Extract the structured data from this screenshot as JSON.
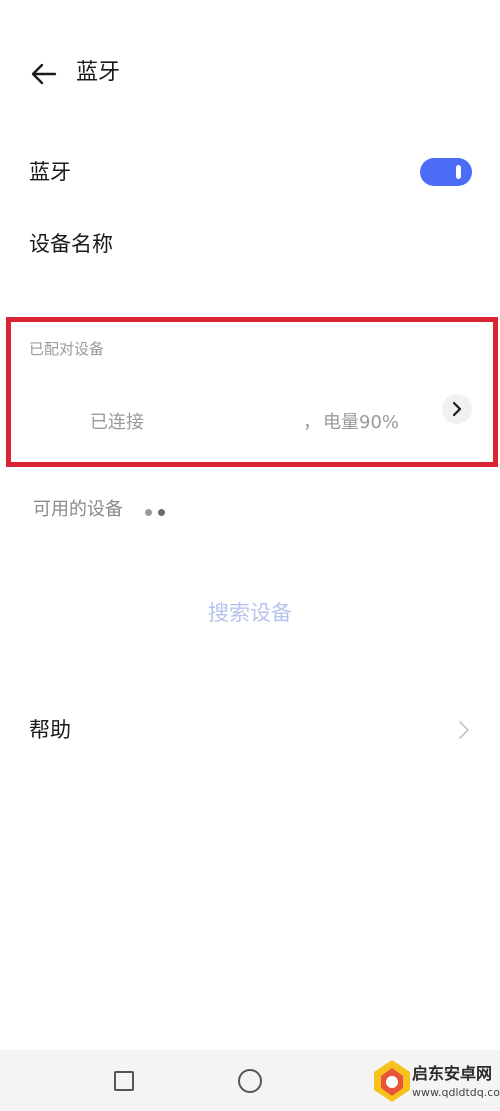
{
  "header": {
    "title": "蓝牙",
    "back_icon": "arrow-left-icon"
  },
  "bluetooth": {
    "label": "蓝牙",
    "toggle_state": "on",
    "toggle_color": "#4a6cf7"
  },
  "device_name": {
    "label": "设备名称"
  },
  "paired": {
    "caption": "已配对设备",
    "device": {
      "status": "已连接",
      "separator": "，",
      "battery": "电量90%",
      "chevron_icon": "chevron-right-icon"
    },
    "highlight_color": "#dc2534"
  },
  "available": {
    "label": "可用的设备",
    "scanning_icon": "loading-dots-icon"
  },
  "search": {
    "label": "搜索设备"
  },
  "help": {
    "label": "帮助",
    "chevron_icon": "chevron-right-icon"
  },
  "navbar": {
    "recents_icon": "square-icon",
    "home_icon": "circle-icon"
  },
  "watermark": {
    "name": "启东安卓网",
    "url": "www.qdldtdq.com"
  }
}
